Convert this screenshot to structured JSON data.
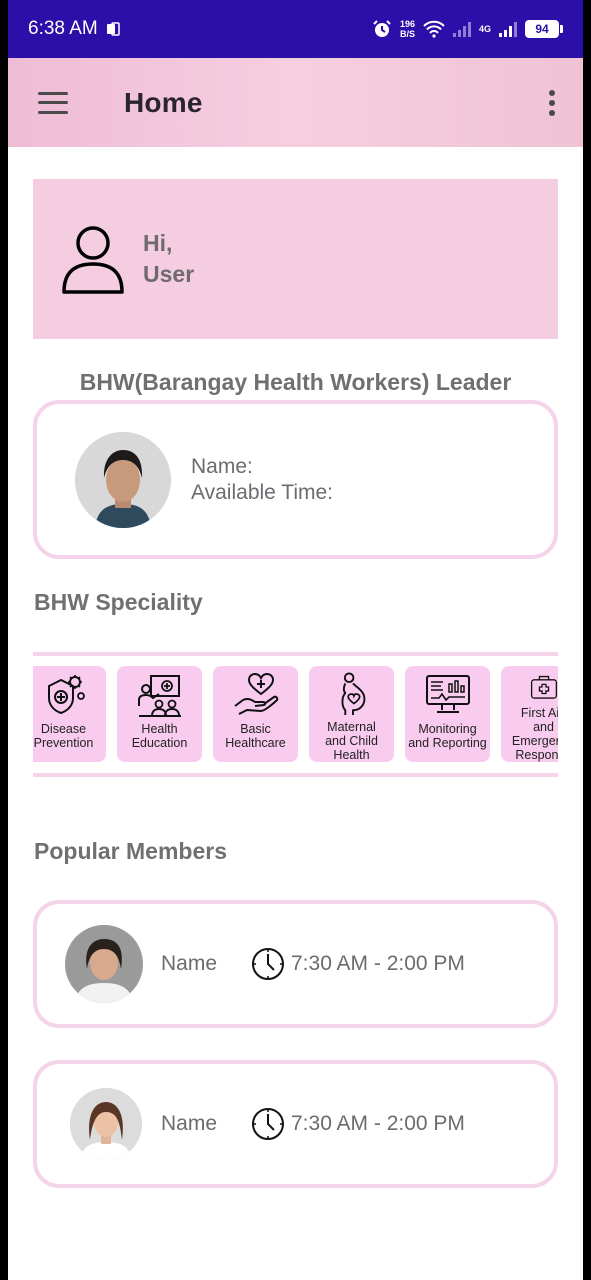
{
  "status_bar": {
    "time": "6:38 AM",
    "net_speed_value": "196",
    "net_speed_unit": "B/S",
    "network": "4G",
    "battery": "94"
  },
  "app_bar": {
    "title": "Home"
  },
  "greeting": {
    "line1": "Hi,",
    "line2": "User"
  },
  "leader": {
    "heading": "BHW(Barangay Health Workers) Leader",
    "name_label": "Name:",
    "time_label": "Available Time:"
  },
  "speciality": {
    "heading": "BHW Speciality",
    "items": [
      {
        "label": "Disease\nPrevention",
        "icon": "virus-shield-icon"
      },
      {
        "label": "Health\nEducation",
        "icon": "presentation-icon"
      },
      {
        "label": "Basic\nHealthcare",
        "icon": "heart-hand-icon"
      },
      {
        "label": "Maternal\nand Child\nHealth",
        "icon": "pregnant-icon"
      },
      {
        "label": "Monitoring\nand Reporting",
        "icon": "monitor-chart-icon"
      },
      {
        "label": "First Aid\nand Emergency\nResponse",
        "icon": "first-aid-kit-icon"
      }
    ]
  },
  "popular": {
    "heading": "Popular Members",
    "members": [
      {
        "name": "Name",
        "time": "7:30 AM - 2:00 PM"
      },
      {
        "name": "Name",
        "time": "7:30 AM - 2:00 PM"
      }
    ]
  },
  "colors": {
    "status_bar": "#2b0fa8",
    "app_bar": "#f5cfe0",
    "greeting_bg": "#f5cde0",
    "card_border": "#f5d3ea",
    "spec_item_bg": "#f9ccef"
  }
}
